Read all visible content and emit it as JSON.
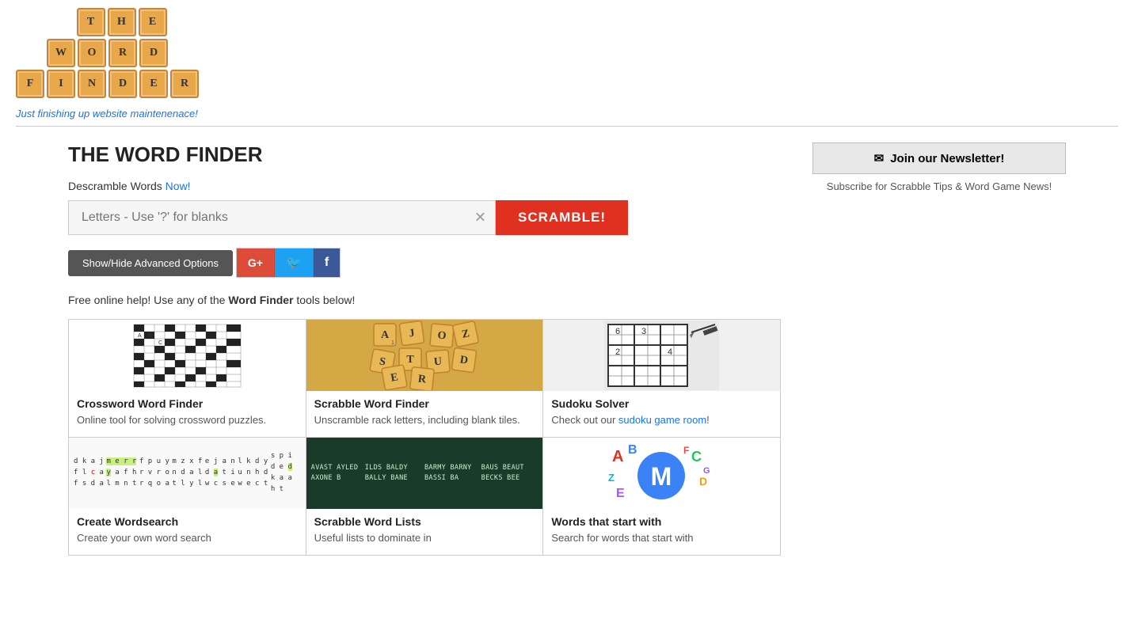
{
  "logo": {
    "tiles": [
      {
        "row": 0,
        "cells": [
          "",
          "T",
          "H",
          "E",
          ""
        ]
      },
      {
        "row": 1,
        "cells": [
          "W",
          "O",
          "R",
          "D",
          ""
        ]
      },
      {
        "row": 2,
        "cells": [
          "F",
          "I",
          "N",
          "D",
          "E",
          "R"
        ]
      }
    ],
    "row1": [
      "",
      "T",
      "H",
      "E",
      ""
    ],
    "row2": [
      "W",
      "O",
      "R",
      "D",
      ""
    ],
    "row3": [
      "F",
      "I",
      "N",
      "D",
      "E"
    ]
  },
  "tagline": "Just finishing up website maintenenace!",
  "page_title": "THE WORD FINDER",
  "newsletter": {
    "button_label": "Join our Newsletter!",
    "subtitle": "Subscribe for Scrabble Tips & Word Game News!"
  },
  "search": {
    "label_prefix": "Descramble Words ",
    "label_link": "Now!",
    "placeholder": "Letters - Use '?' for blanks",
    "button_label": "SCRAMBLE!"
  },
  "advanced_btn": "Show/Hide Advanced Options",
  "social": {
    "google": "G+",
    "twitter": "🐦",
    "facebook": "f"
  },
  "free_help": {
    "prefix": "Free online help! Use any of the ",
    "tool_name": "Word Finder",
    "suffix": " tools below!"
  },
  "tools": {
    "row1": [
      {
        "title": "Crossword Word Finder",
        "desc": "Online tool for solving crossword puzzles.",
        "type": "crossword"
      },
      {
        "title": "Scrabble Word Finder",
        "desc": "Unscramble rack letters, including blank tiles.",
        "type": "scrabble"
      },
      {
        "title": "Sudoku Solver",
        "desc": "Check out our sudoku game room!",
        "type": "sudoku"
      }
    ],
    "row2": [
      {
        "title": "Create Wordsearch",
        "desc": "Create your own word search",
        "type": "wordsearch"
      },
      {
        "title": "Scrabble Word Lists",
        "desc": "Useful lists to dominate in",
        "type": "wordlists"
      },
      {
        "title": "Words that start with",
        "desc": "Search for words that start with",
        "type": "wordstart"
      }
    ]
  }
}
